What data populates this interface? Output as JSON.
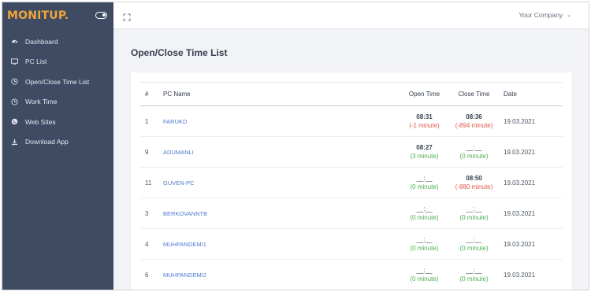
{
  "brand": {
    "name": "MONITUP."
  },
  "sidebar": {
    "items": [
      {
        "label": "Dashboard",
        "icon": "dashboard-icon"
      },
      {
        "label": "PC List",
        "icon": "monitor-icon"
      },
      {
        "label": "Open/Close Time List",
        "icon": "clock-icon"
      },
      {
        "label": "Work Time",
        "icon": "clock-icon"
      },
      {
        "label": "Web Sites",
        "icon": "globe-icon"
      },
      {
        "label": "Download App",
        "icon": "download-icon"
      }
    ]
  },
  "topbar": {
    "company": "Your Company",
    "caret": "⌄"
  },
  "page": {
    "title": "Open/Close Time List"
  },
  "table": {
    "headers": {
      "num": "#",
      "name": "PC Name",
      "open": "Open Time",
      "close": "Close Time",
      "date": "Date"
    },
    "rows": [
      {
        "num": "1",
        "name": "FARUKD",
        "open_time": "08:31",
        "open_diff": "(-1 minute)",
        "close_time": "08:36",
        "close_diff": "(-894 minute)",
        "date": "19.03.2021"
      },
      {
        "num": "9",
        "name": "ADUMANLI",
        "open_time": "08:27",
        "open_diff": "(3 minute)",
        "close_time": "__:__",
        "close_diff": "(0 minute)",
        "date": "19.03.2021"
      },
      {
        "num": "11",
        "name": "GUVEN-PC",
        "open_time": "__:__",
        "open_diff": "(0 minute)",
        "close_time": "08:50",
        "close_diff": "(-880 minute)",
        "date": "19.03.2021"
      },
      {
        "num": "3",
        "name": "BERKOVANNTB",
        "open_time": "__:__",
        "open_diff": "(0 minute)",
        "close_time": "__:__",
        "close_diff": "(0 minute)",
        "date": "19.03.2021"
      },
      {
        "num": "4",
        "name": "MUHPANDEMI1",
        "open_time": "__:__",
        "open_diff": "(0 minute)",
        "close_time": "__:__",
        "close_diff": "(0 minute)",
        "date": "19.03.2021"
      },
      {
        "num": "6",
        "name": "MUHPANDEMI2",
        "open_time": "__:__",
        "open_diff": "(0 minute)",
        "close_time": "__:__",
        "close_diff": "(0 minute)",
        "date": "19.03.2021"
      }
    ]
  },
  "colors": {
    "sidebar": "#3e4b63",
    "brand": "#f0a43a",
    "link": "#4f7bd0",
    "negative": "#e2574c",
    "zero": "#4caf50"
  }
}
